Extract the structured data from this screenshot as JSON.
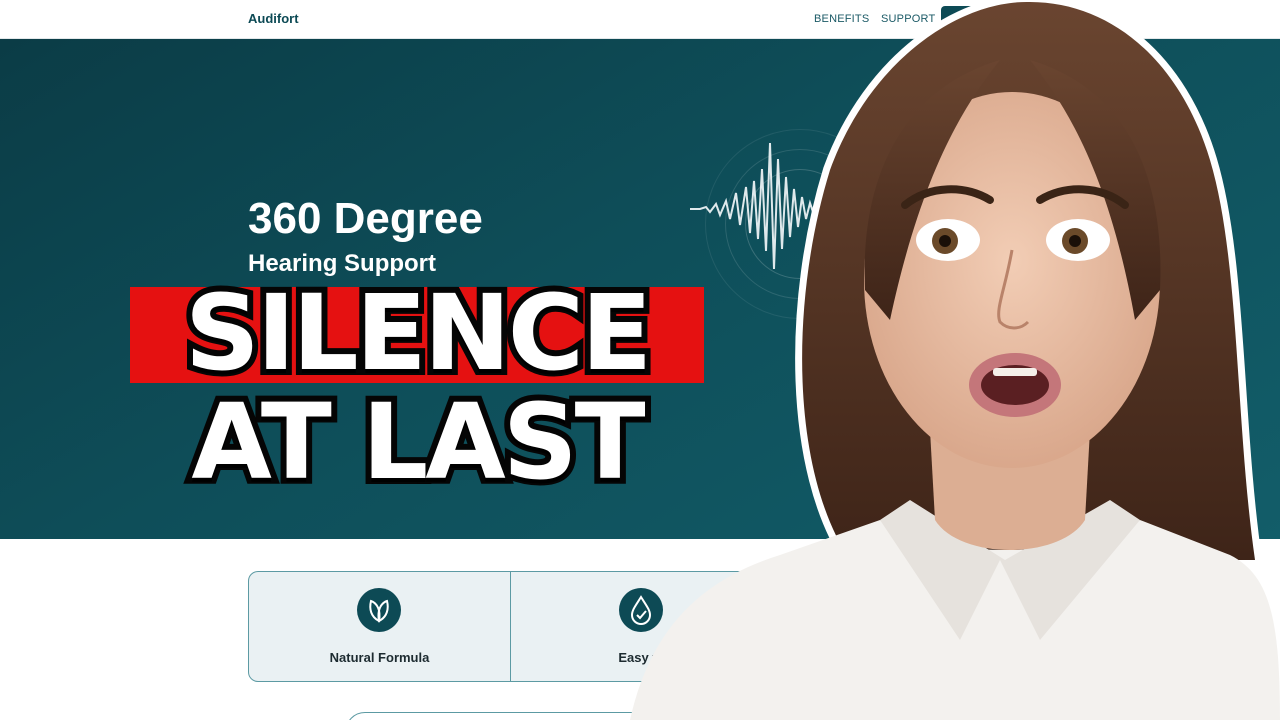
{
  "nav": {
    "brand": "Audifort",
    "links": [
      "BENEFITS",
      "SUPPORT"
    ]
  },
  "hero": {
    "title": "360 Degree",
    "subtitle": "Hearing Support"
  },
  "overlay": {
    "line1": "SILENCE",
    "line2": "AT LAST"
  },
  "features": [
    {
      "label": "Natural Formula",
      "icon": "leaf-icon"
    },
    {
      "label": "Easy to ",
      "icon": "droplet-check-icon"
    }
  ],
  "colors": {
    "brand": "#0d4a55",
    "hero_background": "#0e4e59",
    "headline_highlight": "#e51111",
    "card_background": "#eaf1f3"
  }
}
